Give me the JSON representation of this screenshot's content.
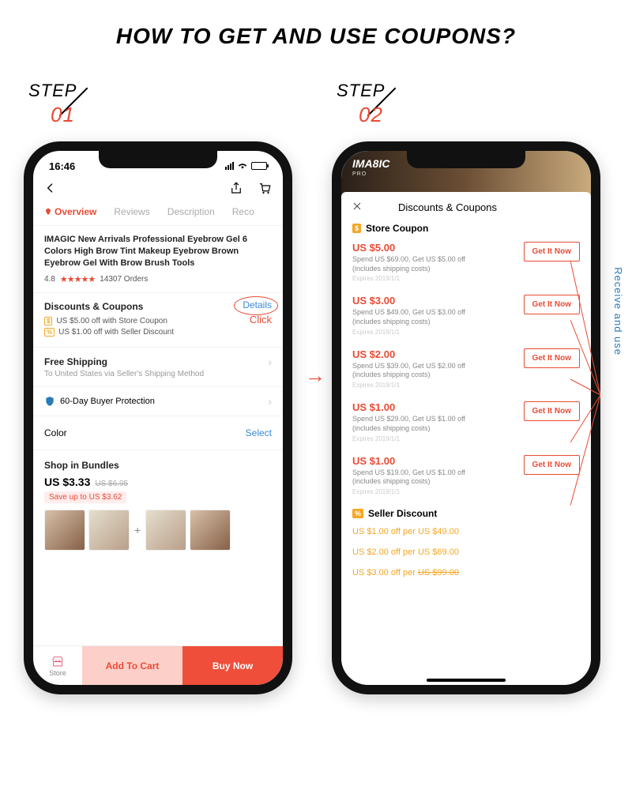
{
  "page_title": "HOW TO GET AND USE COUPONS?",
  "step1": {
    "label": "STEP",
    "num": "01"
  },
  "step2": {
    "label": "STEP",
    "num": "02"
  },
  "arrow_glyph": "→",
  "side_label": "Receive and use",
  "phone1": {
    "time": "16:46",
    "tabs": {
      "overview": "Overview",
      "reviews": "Reviews",
      "description": "Description",
      "reco": "Reco"
    },
    "product_title": "IMAGIC New Arrivals  Professional Eyebrow Gel 6 Colors High Brow Tint Makeup Eyebrow Brown Eyebrow Gel With Brow Brush Tools",
    "rating": "4.8",
    "stars": "★★★★★",
    "orders": "14307 Orders",
    "disc_head": "Discounts & Coupons",
    "disc_badge1": "$",
    "disc_line1": "US $5.00 off with Store Coupon",
    "disc_badge2": "%",
    "disc_line2": "US $1.00 off with Seller Discount",
    "details": "Details",
    "click": "Click",
    "ship_head": "Free Shipping",
    "ship_sub": "To United States via Seller's Shipping Method",
    "protect": "60-Day Buyer Protection",
    "color_label": "Color",
    "select": "Select",
    "bundle_head": "Shop in Bundles",
    "bundle_price": "US $3.33",
    "bundle_old": "US $6.95",
    "bundle_save": "Save up to US $3.62",
    "store": "Store",
    "add_cart": "Add To Cart",
    "buy_now": "Buy Now"
  },
  "phone2": {
    "brand": "IMA8IC",
    "brand_sub": "PRO",
    "sheet_title": "Discounts & Coupons",
    "store_coupon_head": "Store Coupon",
    "badge_dollar": "$",
    "coupons": [
      {
        "amt": "US $5.00",
        "cond": "Spend US $69.00, Get US $5.00 off (includes shipping costs)",
        "exp": "Expires 2019/1/1",
        "btn": "Get It Now"
      },
      {
        "amt": "US $3.00",
        "cond": "Spend US $49.00, Get US $3.00 off (includes shipping costs)",
        "exp": "Expires 2019/1/1",
        "btn": "Get It Now"
      },
      {
        "amt": "US $2.00",
        "cond": "Spend US $39.00, Get US $2.00 off (includes shipping costs)",
        "exp": "Expires 2019/1/1",
        "btn": "Get It Now"
      },
      {
        "amt": "US $1.00",
        "cond": "Spend US $29.00, Get US $1.00 off (includes shipping costs)",
        "exp": "Expires 2019/1/1",
        "btn": "Get It Now"
      },
      {
        "amt": "US $1.00",
        "cond": "Spend US $19.00, Get US $1.00 off (includes shipping costs)",
        "exp": "Expires 2019/1/1",
        "btn": "Get It Now"
      }
    ],
    "seller_head": "Seller Discount",
    "badge_pct": "%",
    "seller_rows": [
      "US $1.00 off per US $49.00",
      "US $2.00 off per US $69.00"
    ],
    "seller_last_pre": "US $3.00 off per ",
    "seller_last_strike": "US $99.00"
  }
}
